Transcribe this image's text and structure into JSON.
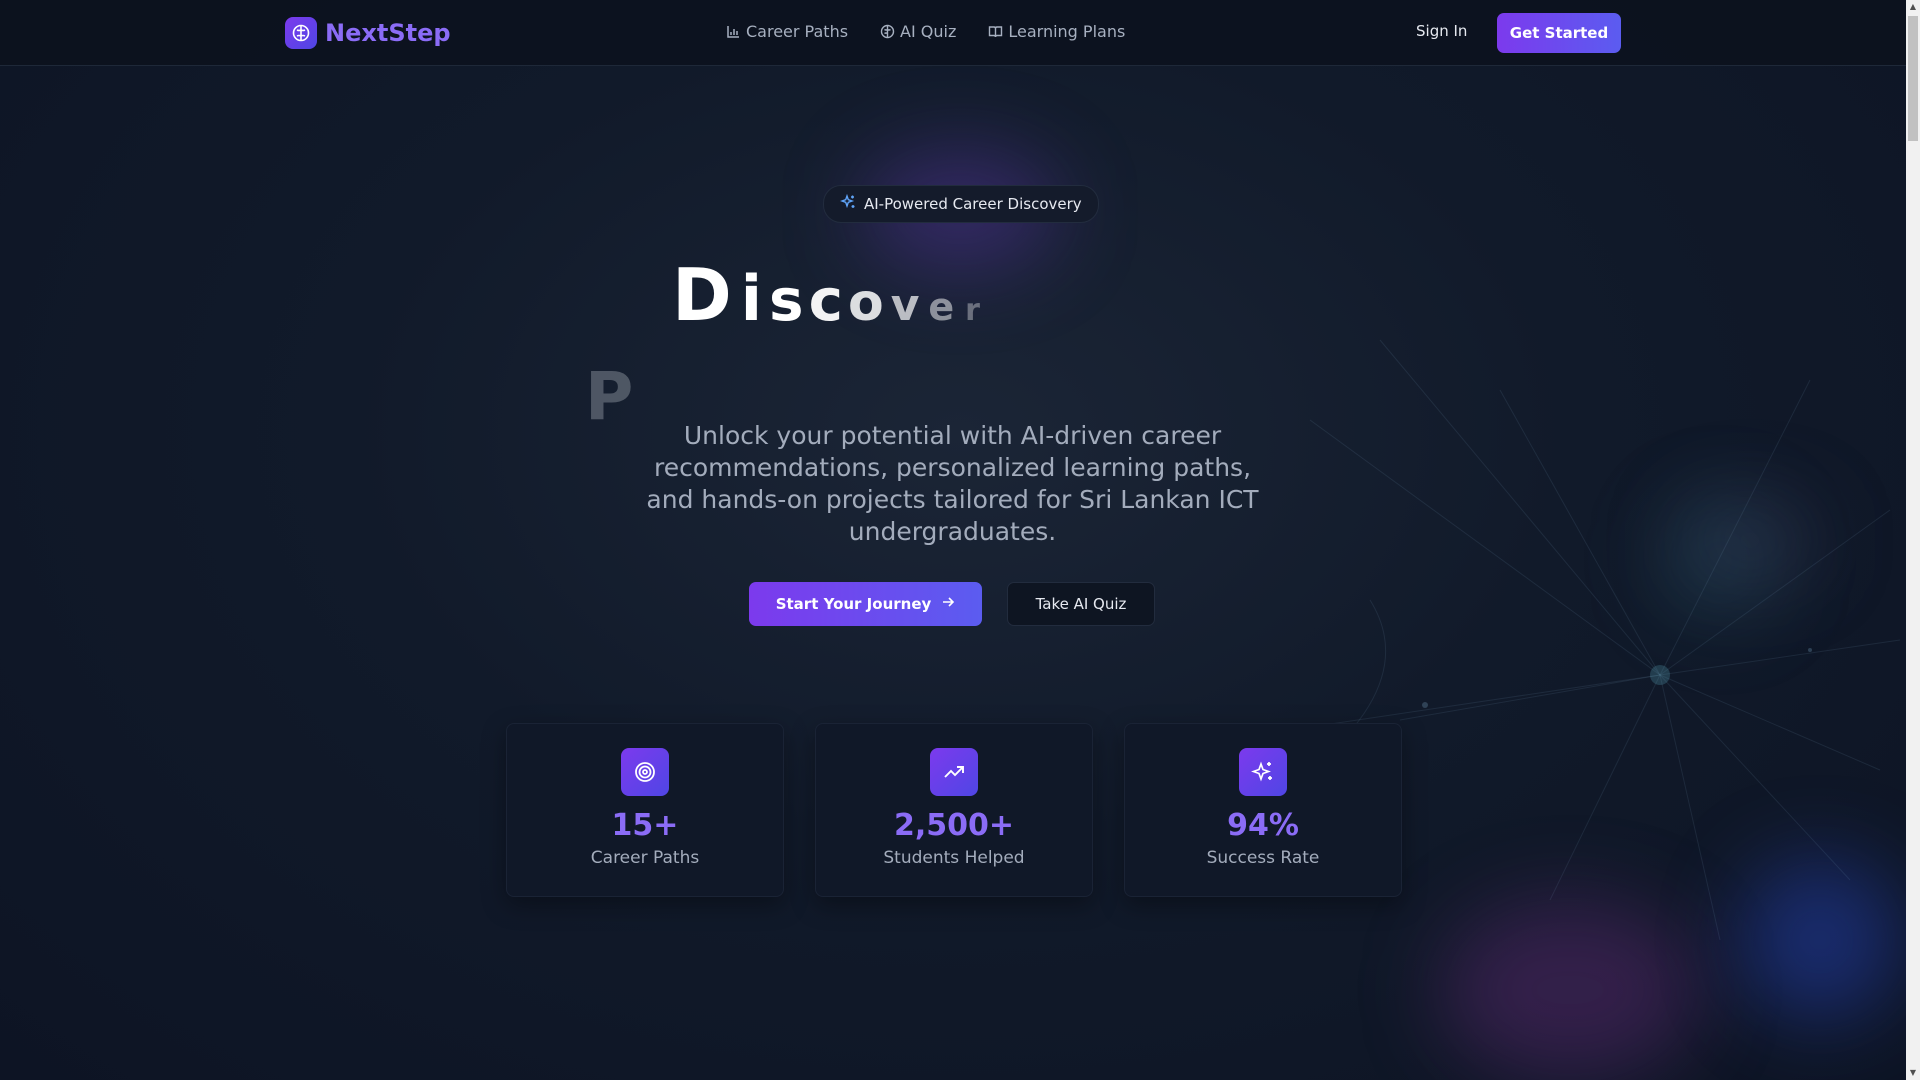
{
  "header": {
    "logo_text": "NextStep",
    "nav": [
      {
        "label": "Career Paths",
        "icon": "bar-chart-icon"
      },
      {
        "label": "AI Quiz",
        "icon": "brain-icon"
      },
      {
        "label": "Learning Plans",
        "icon": "book-icon"
      }
    ],
    "sign_in": "Sign In",
    "get_started": "Get Started"
  },
  "hero": {
    "badge": "AI-Powered Career Discovery",
    "title_letters": [
      "D",
      "i",
      "s",
      "c",
      "o",
      "v",
      "e",
      "r"
    ],
    "title_second_line": "P",
    "subtitle": "Unlock your potential with AI-driven career recommendations, personalized learning paths, and hands-on projects tailored for Sri Lankan ICT undergraduates.",
    "primary_button": "Start Your Journey",
    "secondary_button": "Take AI Quiz"
  },
  "stats": [
    {
      "value": "15+",
      "label": "Career Paths",
      "icon": "target-icon"
    },
    {
      "value": "2,500+",
      "label": "Students Helped",
      "icon": "trending-up-icon"
    },
    {
      "value": "94%",
      "label": "Success Rate",
      "icon": "sparkles-icon"
    }
  ],
  "colors": {
    "accent": "#7c3aed",
    "accent_secondary": "#5b5cf0",
    "stat_value": "#8b6cf6",
    "background": "#111a2a"
  }
}
